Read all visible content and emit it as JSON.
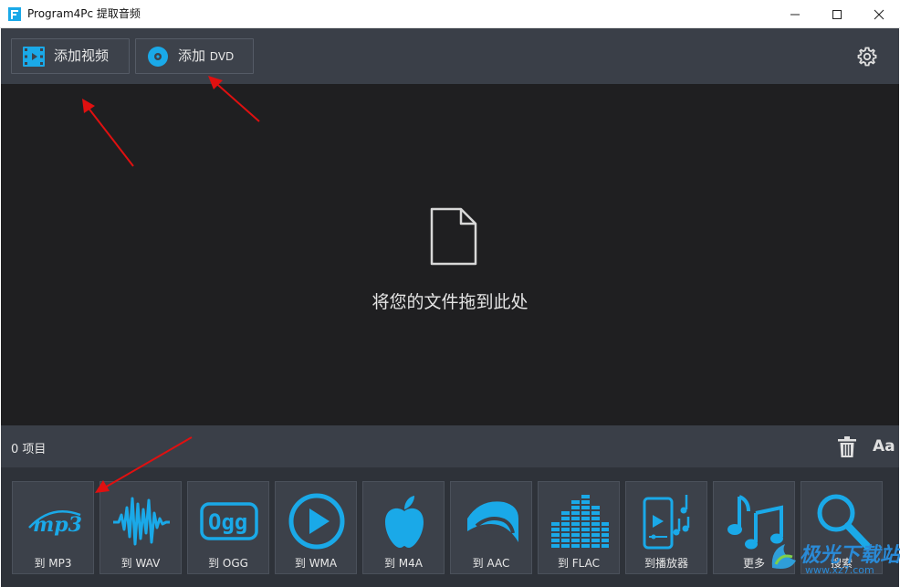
{
  "window": {
    "title": "Program4Pc 提取音频"
  },
  "toolbar": {
    "add_video_label": "添加视频",
    "add_dvd_label_main": "添加",
    "add_dvd_label_suffix": "DVD"
  },
  "dropzone": {
    "text": "将您的文件拖到此处"
  },
  "status": {
    "count_text": "0 项目",
    "font_label": "Aa"
  },
  "formats": [
    {
      "label": "到 MP3",
      "icon": "mp3-icon"
    },
    {
      "label": "到 WAV",
      "icon": "waveform-icon"
    },
    {
      "label": "到 OGG",
      "icon": "ogg-icon"
    },
    {
      "label": "到 WMA",
      "icon": "play-circle-icon"
    },
    {
      "label": "到 M4A",
      "icon": "apple-icon"
    },
    {
      "label": "到 AAC",
      "icon": "aac-icon"
    },
    {
      "label": "到 FLAC",
      "icon": "equalizer-icon"
    },
    {
      "label": "到播放器",
      "icon": "phone-music-icon"
    },
    {
      "label": "更多",
      "icon": "music-notes-icon"
    },
    {
      "label": "搜索",
      "icon": "search-icon"
    }
  ],
  "watermark": {
    "text": "极光下载站",
    "sub": "www.xz7.com"
  },
  "colors": {
    "accent": "#1aa9e8",
    "toolbar": "#3a3f48",
    "dropzone": "#1f1f21",
    "annotation": "#e01010"
  }
}
